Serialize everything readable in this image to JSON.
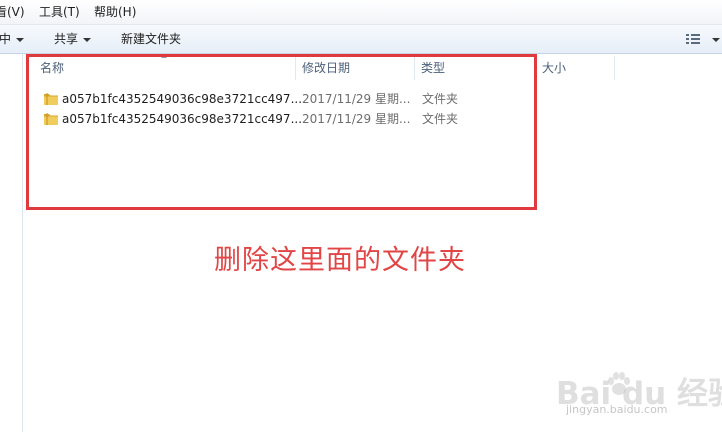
{
  "menubar": {
    "items": [
      "看(V)",
      "工具(T)",
      "帮助(H)"
    ]
  },
  "toolbar": {
    "partial_label": "中",
    "share_label": "共享",
    "new_folder_label": "新建文件夹"
  },
  "columns": {
    "name": "名称",
    "modified": "修改日期",
    "type": "类型",
    "size": "大小"
  },
  "files": [
    {
      "name": "a057b1fc4352549036c98e3721cc497...",
      "modified": "2017/11/29 星期...",
      "type": "文件夹",
      "icon": "folder-icon"
    },
    {
      "name": "a057b1fc4352549036c98e3721cc497...",
      "modified": "2017/11/29 星期...",
      "type": "文件夹",
      "icon": "folder-icon"
    }
  ],
  "annotation": {
    "text": "删除这里面的文件夹",
    "color": "#e24545"
  },
  "watermark": {
    "brand": "Bai du 经验",
    "url": "jingyan.baidu.com"
  },
  "colors": {
    "highlight": "#e0393e",
    "header_text": "#4c607a",
    "folder": "#e8c04a"
  }
}
